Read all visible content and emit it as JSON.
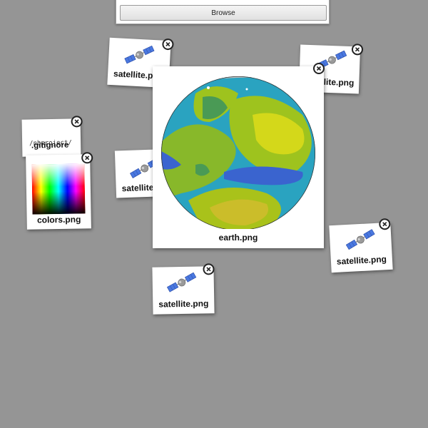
{
  "uploader": {
    "browse_label": "Browse"
  },
  "files": [
    {
      "id": "sat1",
      "name": "satellite.png",
      "icon": "satellite-icon"
    },
    {
      "id": "sat2",
      "name": "satellite.png",
      "icon": "satellite-icon"
    },
    {
      "id": "gitignore",
      "name": ".gitignore",
      "preview_lines": [
        "/nbproject/",
        "*~"
      ]
    },
    {
      "id": "sat3",
      "name": "satellite.png",
      "icon": "satellite-icon"
    },
    {
      "id": "colors",
      "name": "colors.png",
      "icon": "color-spectrum-image"
    },
    {
      "id": "earth",
      "name": "earth.png",
      "icon": "earth-globe-image"
    },
    {
      "id": "sat4",
      "name": "satellite.png",
      "icon": "satellite-icon"
    },
    {
      "id": "sat5",
      "name": "satellite.png",
      "icon": "satellite-icon"
    }
  ],
  "colors": {
    "background": "#959595",
    "card": "#ffffff",
    "satellite_panel": "#4a78e0"
  }
}
